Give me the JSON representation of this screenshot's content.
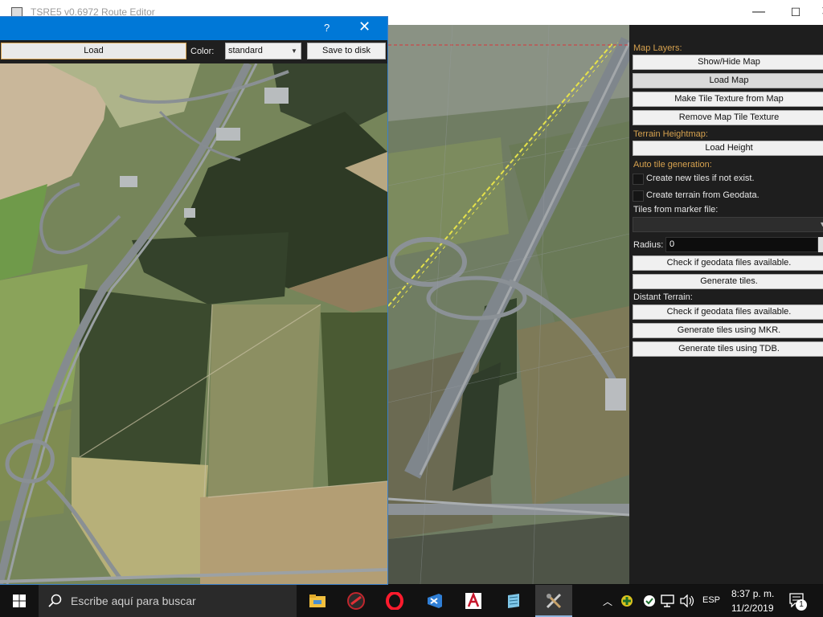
{
  "window": {
    "title": "TSRE5 v0.6972 Route Editor",
    "minimize_glyph": "—",
    "maximize_glyph": "☐",
    "close_glyph": "✕"
  },
  "map_dialog": {
    "help_glyph": "?",
    "close_glyph": "✕",
    "load_label": "Load",
    "color_label": "Color:",
    "color_value": "standard",
    "save_label": "Save to disk"
  },
  "panel": {
    "map_layers_heading": "Map Layers:",
    "show_hide_map": "Show/Hide Map",
    "load_map": "Load Map",
    "make_tile_texture": "Make Tile Texture from Map",
    "remove_map_tile_texture": "Remove Map Tile Texture",
    "terrain_heightmap_heading": "Terrain Heightmap:",
    "load_height": "Load Height",
    "auto_tile_heading": "Auto tile generation:",
    "create_new_tiles": "Create new tiles if not exist.",
    "create_terrain_geodata": "Create terrain from Geodata.",
    "tiles_from_marker_label": "Tiles from marker file:",
    "marker_file_value": "",
    "radius_label": "Radius:",
    "radius_value": "0",
    "check_geodata_1": "Check if geodata files available.",
    "generate_tiles": "Generate tiles.",
    "distant_terrain_heading": "Distant Terrain:",
    "check_geodata_2": "Check if geodata files available.",
    "generate_mkr": "Generate tiles using MKR.",
    "generate_tdb": "Generate tiles using TDB."
  },
  "taskbar": {
    "search_placeholder": "Escribe aquí para buscar",
    "language": "ESP",
    "time": "8:37 p. m.",
    "date": "11/2/2019",
    "notification_count": "1",
    "icons": [
      "windows-start-icon",
      "file-explorer-icon",
      "unknown-app-icon",
      "opera-icon",
      "visual-studio-icon",
      "autocad-icon",
      "notepad-icon",
      "tools-icon"
    ]
  },
  "colors": {
    "accent_blue": "#0078d7",
    "section_orange": "#d7a24f",
    "panel_bg": "#1e1e1e"
  }
}
